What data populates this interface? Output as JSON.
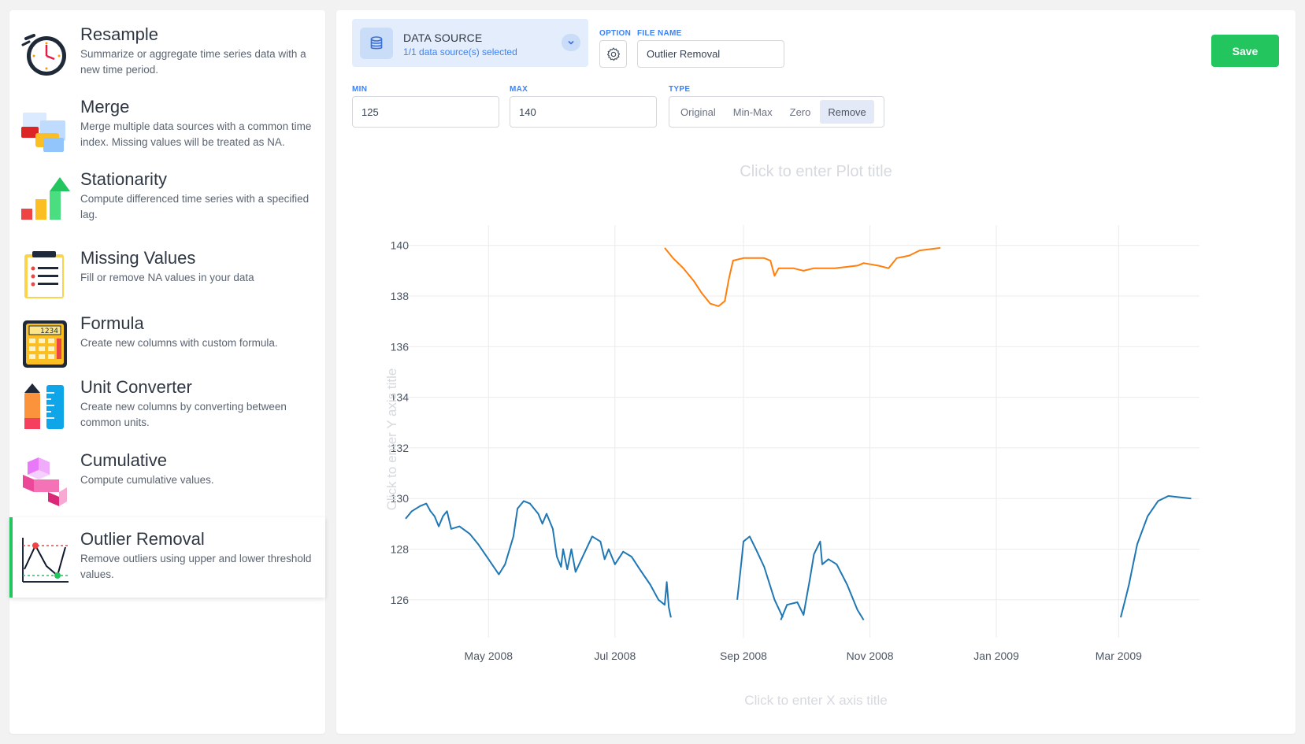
{
  "tools": [
    {
      "title": "Resample",
      "desc": "Summarize or aggregate time series data with a new time period.",
      "icon": "stopwatch-icon"
    },
    {
      "title": "Merge",
      "desc": "Merge multiple data sources with a common time index. Missing values will be treated as NA.",
      "icon": "merge-cards-icon"
    },
    {
      "title": "Stationarity",
      "desc": "Compute differenced time series with a specified lag.",
      "icon": "bar-arrow-icon"
    },
    {
      "title": "Missing Values",
      "desc": "Fill or remove NA values in your data",
      "icon": "clipboard-list-icon"
    },
    {
      "title": "Formula",
      "desc": "Create new columns with custom formula.",
      "icon": "calculator-icon"
    },
    {
      "title": "Unit Converter",
      "desc": "Create new columns by converting between common units.",
      "icon": "ruler-icon"
    },
    {
      "title": "Cumulative",
      "desc": "Compute cumulative values.",
      "icon": "cubes-icon"
    },
    {
      "title": "Outlier Removal",
      "desc": "Remove outliers using upper and lower threshold values.",
      "icon": "outlier-chart-icon",
      "active": true
    }
  ],
  "data_source": {
    "title": "DATA SOURCE",
    "subtitle": "1/1 data source(s) selected"
  },
  "option_label": "OPTION",
  "file_name": {
    "label": "FILE NAME",
    "value": "Outlier Removal"
  },
  "save_label": "Save",
  "min": {
    "label": "MIN",
    "value": "125"
  },
  "max": {
    "label": "MAX",
    "value": "140"
  },
  "type": {
    "label": "TYPE",
    "options": [
      "Original",
      "Min-Max",
      "Zero",
      "Remove"
    ],
    "selected": "Remove"
  },
  "colors": {
    "accent": "#22c55e",
    "link": "#3b82f6",
    "series_blue": "#1f77b4",
    "series_orange": "#ff7f0e"
  },
  "chart_data": {
    "type": "line",
    "title": "Click to enter Plot title",
    "xlabel": "Click to enter X axis title",
    "ylabel": "Click to enter Y axis title",
    "x_ticks": [
      "May 2008",
      "Jul 2008",
      "Sep 2008",
      "Nov 2008",
      "Jan 2009",
      "Mar 2009"
    ],
    "x_tick_dates": [
      "2008-05-01",
      "2008-07-01",
      "2008-09-01",
      "2008-11-01",
      "2009-01-01",
      "2009-03-01"
    ],
    "xlim": [
      "2008-03-22",
      "2009-04-09"
    ],
    "y_ticks": [
      126,
      128,
      130,
      132,
      134,
      136,
      138,
      140
    ],
    "ylim": [
      124.5,
      140.8
    ],
    "grid": true,
    "series": [
      {
        "color": "#1f77b4",
        "segments": [
          [
            [
              "2008-03-22",
              129.2
            ],
            [
              "2008-03-25",
              129.5
            ],
            [
              "2008-03-29",
              129.7
            ],
            [
              "2008-04-01",
              129.8
            ],
            [
              "2008-04-03",
              129.5
            ],
            [
              "2008-04-05",
              129.3
            ],
            [
              "2008-04-07",
              128.9
            ],
            [
              "2008-04-09",
              129.3
            ],
            [
              "2008-04-11",
              129.5
            ],
            [
              "2008-04-13",
              128.8
            ],
            [
              "2008-04-17",
              128.9
            ],
            [
              "2008-04-22",
              128.6
            ],
            [
              "2008-04-26",
              128.2
            ],
            [
              "2008-05-01",
              127.6
            ],
            [
              "2008-05-06",
              127.0
            ],
            [
              "2008-05-09",
              127.4
            ],
            [
              "2008-05-13",
              128.5
            ],
            [
              "2008-05-15",
              129.6
            ],
            [
              "2008-05-18",
              129.9
            ],
            [
              "2008-05-21",
              129.8
            ],
            [
              "2008-05-25",
              129.4
            ],
            [
              "2008-05-27",
              129.0
            ],
            [
              "2008-05-29",
              129.4
            ],
            [
              "2008-06-01",
              128.8
            ],
            [
              "2008-06-03",
              127.7
            ],
            [
              "2008-06-05",
              127.3
            ],
            [
              "2008-06-06",
              128.0
            ],
            [
              "2008-06-08",
              127.2
            ],
            [
              "2008-06-10",
              128.0
            ],
            [
              "2008-06-12",
              127.1
            ],
            [
              "2008-06-16",
              127.8
            ],
            [
              "2008-06-20",
              128.5
            ],
            [
              "2008-06-24",
              128.3
            ],
            [
              "2008-06-26",
              127.6
            ],
            [
              "2008-06-28",
              128.0
            ],
            [
              "2008-07-01",
              127.4
            ],
            [
              "2008-07-05",
              127.9
            ],
            [
              "2008-07-09",
              127.7
            ],
            [
              "2008-07-13",
              127.2
            ],
            [
              "2008-07-18",
              126.6
            ],
            [
              "2008-07-22",
              126.0
            ],
            [
              "2008-07-25",
              125.8
            ],
            [
              "2008-07-26",
              126.7
            ],
            [
              "2008-07-27",
              125.7
            ],
            [
              "2008-07-28",
              125.3
            ]
          ],
          [
            [
              "2008-08-29",
              126.0
            ],
            [
              "2008-08-31",
              127.5
            ],
            [
              "2008-09-01",
              128.3
            ],
            [
              "2008-09-04",
              128.5
            ],
            [
              "2008-09-07",
              128.0
            ],
            [
              "2008-09-11",
              127.3
            ],
            [
              "2008-09-16",
              126.0
            ],
            [
              "2008-09-20",
              125.3
            ]
          ],
          [
            [
              "2008-09-19",
              125.2
            ],
            [
              "2008-09-22",
              125.8
            ],
            [
              "2008-09-27",
              125.9
            ],
            [
              "2008-09-30",
              125.4
            ],
            [
              "2008-10-03",
              126.8
            ],
            [
              "2008-10-05",
              127.8
            ],
            [
              "2008-10-08",
              128.3
            ],
            [
              "2008-10-09",
              127.4
            ],
            [
              "2008-10-12",
              127.6
            ],
            [
              "2008-10-16",
              127.4
            ],
            [
              "2008-10-21",
              126.6
            ],
            [
              "2008-10-26",
              125.6
            ],
            [
              "2008-10-29",
              125.2
            ]
          ],
          [
            [
              "2009-03-02",
              125.3
            ],
            [
              "2009-03-06",
              126.6
            ],
            [
              "2009-03-10",
              128.2
            ],
            [
              "2009-03-15",
              129.3
            ],
            [
              "2009-03-20",
              129.9
            ],
            [
              "2009-03-25",
              130.1
            ],
            [
              "2009-04-05",
              130.0
            ]
          ]
        ]
      },
      {
        "color": "#ff7f0e",
        "segments": [
          [
            [
              "2008-07-25",
              139.9
            ],
            [
              "2008-07-29",
              139.5
            ],
            [
              "2008-08-03",
              139.1
            ],
            [
              "2008-08-08",
              138.6
            ],
            [
              "2008-08-12",
              138.1
            ],
            [
              "2008-08-16",
              137.7
            ],
            [
              "2008-08-20",
              137.6
            ],
            [
              "2008-08-23",
              137.8
            ],
            [
              "2008-08-25",
              138.7
            ],
            [
              "2008-08-27",
              139.4
            ],
            [
              "2008-09-01",
              139.5
            ],
            [
              "2008-09-07",
              139.5
            ],
            [
              "2008-09-11",
              139.5
            ],
            [
              "2008-09-14",
              139.4
            ],
            [
              "2008-09-16",
              138.8
            ],
            [
              "2008-09-18",
              139.1
            ],
            [
              "2008-09-25",
              139.1
            ],
            [
              "2008-09-30",
              139.0
            ],
            [
              "2008-10-05",
              139.1
            ],
            [
              "2008-10-15",
              139.1
            ],
            [
              "2008-10-26",
              139.2
            ],
            [
              "2008-10-29",
              139.3
            ],
            [
              "2008-11-05",
              139.2
            ],
            [
              "2008-11-10",
              139.1
            ],
            [
              "2008-11-14",
              139.5
            ],
            [
              "2008-11-20",
              139.6
            ],
            [
              "2008-11-25",
              139.8
            ],
            [
              "2008-12-05",
              139.9
            ]
          ]
        ]
      }
    ]
  }
}
